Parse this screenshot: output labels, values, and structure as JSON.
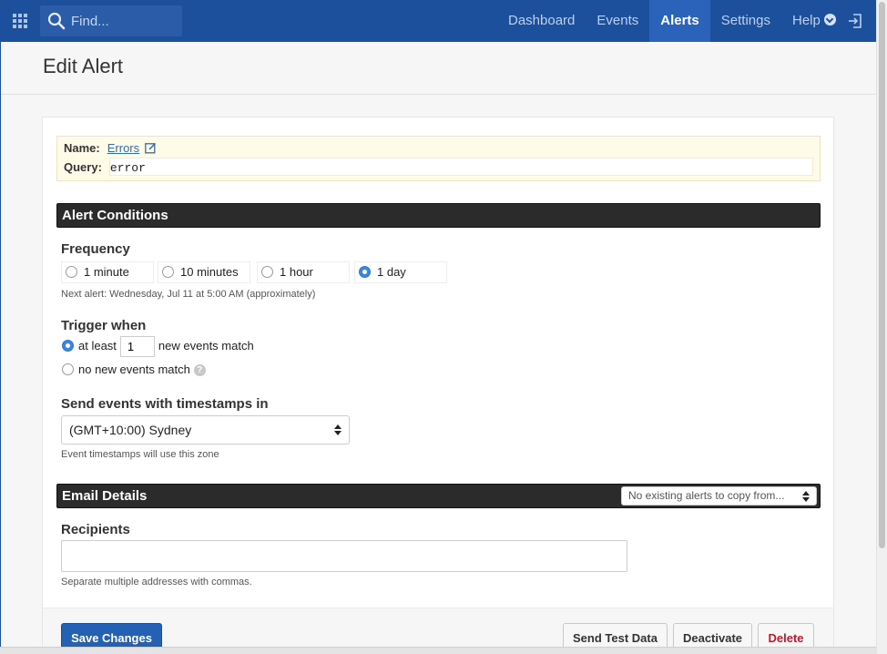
{
  "topbar": {
    "search_placeholder": "Find...",
    "nav": [
      "Dashboard",
      "Events",
      "Alerts",
      "Settings",
      "Help"
    ],
    "active_nav": "Alerts",
    "color": "#1c4f9c"
  },
  "page": {
    "title": "Edit Alert"
  },
  "info": {
    "name_label": "Name:",
    "name_value": "Errors",
    "query_label": "Query:",
    "query_value": "error"
  },
  "conditions": {
    "section_title": "Alert Conditions",
    "frequency_label": "Frequency",
    "frequency_options": [
      "1 minute",
      "10 minutes",
      "1 hour",
      "1 day"
    ],
    "frequency_selected": "1 day",
    "next_alert": "Next alert: Wednesday, Jul 11 at 5:00 AM (approximately)",
    "trigger_label": "Trigger when",
    "trigger_at_least": "at least",
    "trigger_count": "1",
    "trigger_events_match": "new events match",
    "trigger_no_new": "no new events match",
    "trigger_selected": "at least",
    "timezone_label": "Send events with timestamps in",
    "timezone_value": "(GMT+10:00) Sydney",
    "timezone_hint": "Event timestamps will use this zone"
  },
  "email": {
    "section_title": "Email Details",
    "copy_select": "No existing alerts to copy from...",
    "recipients_label": "Recipients",
    "recipients_value": "",
    "recipients_hint": "Separate multiple addresses with commas."
  },
  "actions": {
    "save": "Save Changes",
    "send_test": "Send Test Data",
    "deactivate": "Deactivate",
    "delete": "Delete"
  }
}
